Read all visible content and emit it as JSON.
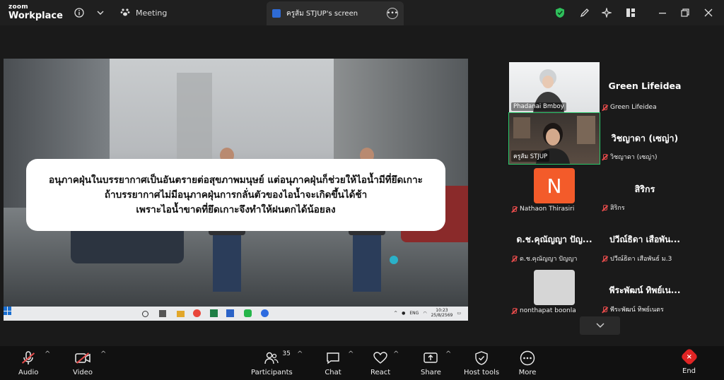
{
  "app": {
    "logo_line1": "zoom",
    "logo_line2": "Workplace"
  },
  "topbar": {
    "meeting_label": "Meeting",
    "screen_tab_label": "ครูส้ม STJUP's screen",
    "icons": [
      "info-icon",
      "chevron-down-icon",
      "paw-icon",
      "more-icon",
      "shield-icon",
      "pen-icon",
      "sparkle-icon",
      "layout-icon",
      "minimize-icon",
      "restore-icon",
      "close-icon"
    ]
  },
  "shared_screen": {
    "caption_lines": [
      "อนุภาคฝุ่นในบรรยากาศเป็นอันตรายต่อสุขภาพมนุษย์ แต่อนุภาคฝุ่นก็ช่วยให้ไอน้ำมีที่ยึดเกาะ",
      "ถ้าบรรยากาศไม่มีอนุภาคฝุ่นการกลั่นตัวของไอน้ำจะเกิดขึ้นได้ช้า",
      "เพราะไอน้ำขาดที่ยึดเกาะจึงทำให้ฝนตกได้น้อยลง"
    ],
    "taskbar": {
      "lang": "ENG",
      "time": "10:23",
      "date": "25/8/2569"
    }
  },
  "gallery": {
    "tiles": [
      {
        "video_name": "Phadanai Bmboy",
        "kind": "video"
      },
      {
        "big_name": "Green Lifeidea",
        "footer_name": "Green Lifeidea",
        "kind": "name"
      },
      {
        "video_name": "ครูส้ม STJUP",
        "kind": "video",
        "active": true
      },
      {
        "big_name": "วิชญาดา (เซญ่า)",
        "footer_name": "วิชญาดา (เซญ่า)",
        "kind": "name"
      },
      {
        "avatar_letter": "N",
        "footer_name": "Nathaon Thirasiri",
        "kind": "avatar"
      },
      {
        "big_name": "สิริกร",
        "footer_name": "สิริกร",
        "kind": "name"
      },
      {
        "big_name": "ด.ช.คุณัญญา ปัญ...",
        "footer_name": "ด.ช.คุณัญญา ปัญญา",
        "kind": "name"
      },
      {
        "big_name": "ปวีณ์ธิดา เสือพัน...",
        "footer_name": "ปวีณ์ธิดา เสือพันธ์ ม.3",
        "kind": "name"
      },
      {
        "footer_name": "nonthapat boonla",
        "kind": "blank"
      },
      {
        "big_name": "พีระพัฒน์ ทิพย์เน...",
        "footer_name": "พีระพัฒน์ ทิพย์เนตร",
        "kind": "name"
      }
    ]
  },
  "toolbar": {
    "audio": "Audio",
    "video": "Video",
    "participants": "Participants",
    "participants_count": "35",
    "chat": "Chat",
    "react": "React",
    "share": "Share",
    "host_tools": "Host tools",
    "more": "More",
    "end": "End"
  },
  "colors": {
    "active_speaker": "#29c769",
    "end_red": "#e02424",
    "avatar_orange": "#f35b2a"
  }
}
